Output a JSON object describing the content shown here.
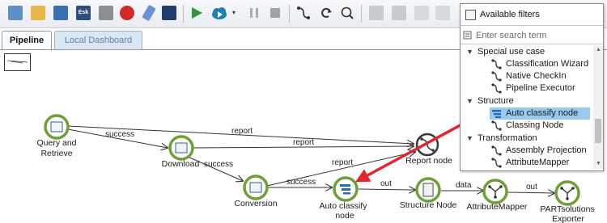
{
  "tabs": [
    {
      "label": "Pipeline",
      "active": true
    },
    {
      "label": "Local Dashboard",
      "active": false
    }
  ],
  "toolbar": {
    "icons": [
      "open-icon",
      "folder-icon",
      "save-icon",
      "esk-icon",
      "edit-icon",
      "stop-sign-icon",
      "eraser-icon",
      "console-icon",
      "run-icon",
      "cloud-upload-icon",
      "pause-icon",
      "stop-icon",
      "connection-icon",
      "refresh-icon",
      "search-zoom-icon",
      "copy-icon",
      "paste-icon",
      "undo-icon",
      "redo-icon"
    ],
    "esk_label": "Esk"
  },
  "nodes": [
    {
      "id": "query",
      "label_lines": [
        "Query and",
        "Retrieve"
      ]
    },
    {
      "id": "download",
      "label_lines": [
        "Download"
      ]
    },
    {
      "id": "conversion",
      "label_lines": [
        "Conversion"
      ]
    },
    {
      "id": "report",
      "label_lines": [
        "Report node"
      ]
    },
    {
      "id": "autoclassify",
      "label_lines": [
        "Auto classify",
        "node"
      ]
    },
    {
      "id": "structure",
      "label_lines": [
        "Structure Node"
      ]
    },
    {
      "id": "attributemapper",
      "label_lines": [
        "AttributeMapper"
      ]
    },
    {
      "id": "partsolutions",
      "label_lines": [
        "PARTsolutions",
        "Exporter"
      ]
    }
  ],
  "edges": {
    "query_download": "success",
    "query_report": "report",
    "download_report": "report",
    "download_conversion": "success",
    "conversion_report": "report",
    "conversion_autoclassify": "success",
    "autoclassify_structure": "out",
    "structure_attributemapper": "data",
    "attributemapper_partsolutions": "out"
  },
  "filter_panel": {
    "title": "Available filters",
    "search_placeholder": "Enter search term",
    "tree": [
      {
        "type": "category",
        "label": "Special use case"
      },
      {
        "type": "item",
        "label": "Classification Wizard"
      },
      {
        "type": "item",
        "label": "Native CheckIn"
      },
      {
        "type": "item",
        "label": "Pipeline Executor"
      },
      {
        "type": "category",
        "label": "Structure"
      },
      {
        "type": "item",
        "label": "Auto classify node",
        "selected": true
      },
      {
        "type": "item",
        "label": "Classing Node"
      },
      {
        "type": "category",
        "label": "Transformation"
      },
      {
        "type": "item",
        "label": "Assembly Projection"
      },
      {
        "type": "item",
        "label": "AttributeMapper"
      }
    ]
  },
  "colors": {
    "node_ring": "#6ea038",
    "node_ring_dark": "#4e7a24",
    "drag_arrow": "#e3242b",
    "selected_row": "#99c9ee",
    "inactive_tab": "#d8e7f3"
  }
}
